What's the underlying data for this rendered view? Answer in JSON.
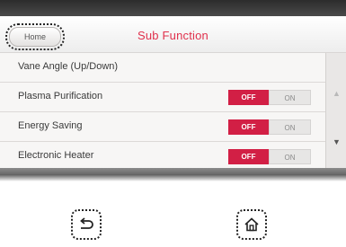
{
  "header": {
    "home_label": "Home",
    "title": "Sub Function"
  },
  "list": {
    "items": [
      {
        "label": "Vane Angle (Up/Down)",
        "has_toggle": false
      },
      {
        "label": "Plasma Purification",
        "has_toggle": true,
        "off_label": "OFF",
        "on_label": "ON",
        "state": "off"
      },
      {
        "label": "Energy Saving",
        "has_toggle": true,
        "off_label": "OFF",
        "on_label": "ON",
        "state": "off"
      },
      {
        "label": "Electronic Heater",
        "has_toggle": true,
        "off_label": "OFF",
        "on_label": "ON",
        "state": "off"
      }
    ]
  },
  "scrollbar": {
    "up_icon": "triangle-up-icon",
    "down_icon": "triangle-down-icon"
  },
  "hardware_buttons": {
    "back_icon": "back-arrow-icon",
    "home_icon": "house-icon"
  },
  "colors": {
    "accent": "#e0304c",
    "toggle_off": "#d21f45"
  }
}
